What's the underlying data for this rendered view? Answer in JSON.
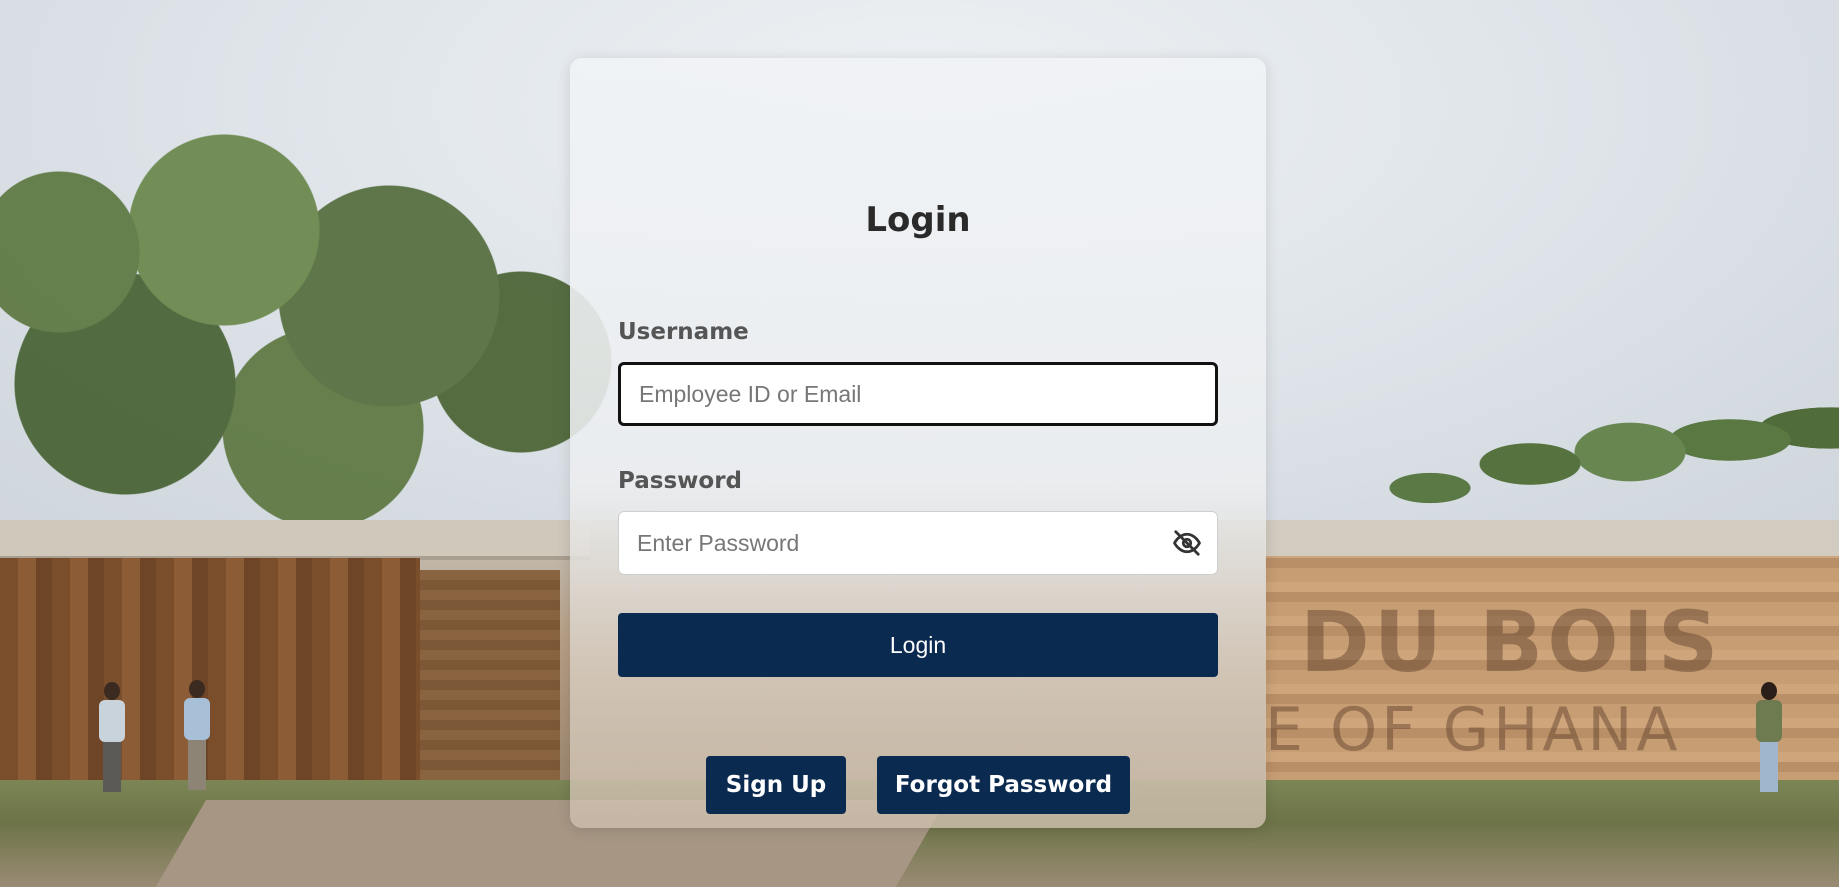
{
  "background": {
    "sign_line_1": "DU BOIS",
    "sign_line_2": "E OF GHANA"
  },
  "login_form": {
    "title": "Login",
    "username": {
      "label": "Username",
      "placeholder": "Employee ID or Email",
      "value": ""
    },
    "password": {
      "label": "Password",
      "placeholder": "Enter Password",
      "value": "",
      "toggle_icon": "eye-slash-icon"
    },
    "submit_label": "Login",
    "signup_label": "Sign Up",
    "forgot_label": "Forgot Password"
  },
  "colors": {
    "primary": "#0b2a50",
    "title_text": "#2a2a2a",
    "label_text": "#555555"
  }
}
